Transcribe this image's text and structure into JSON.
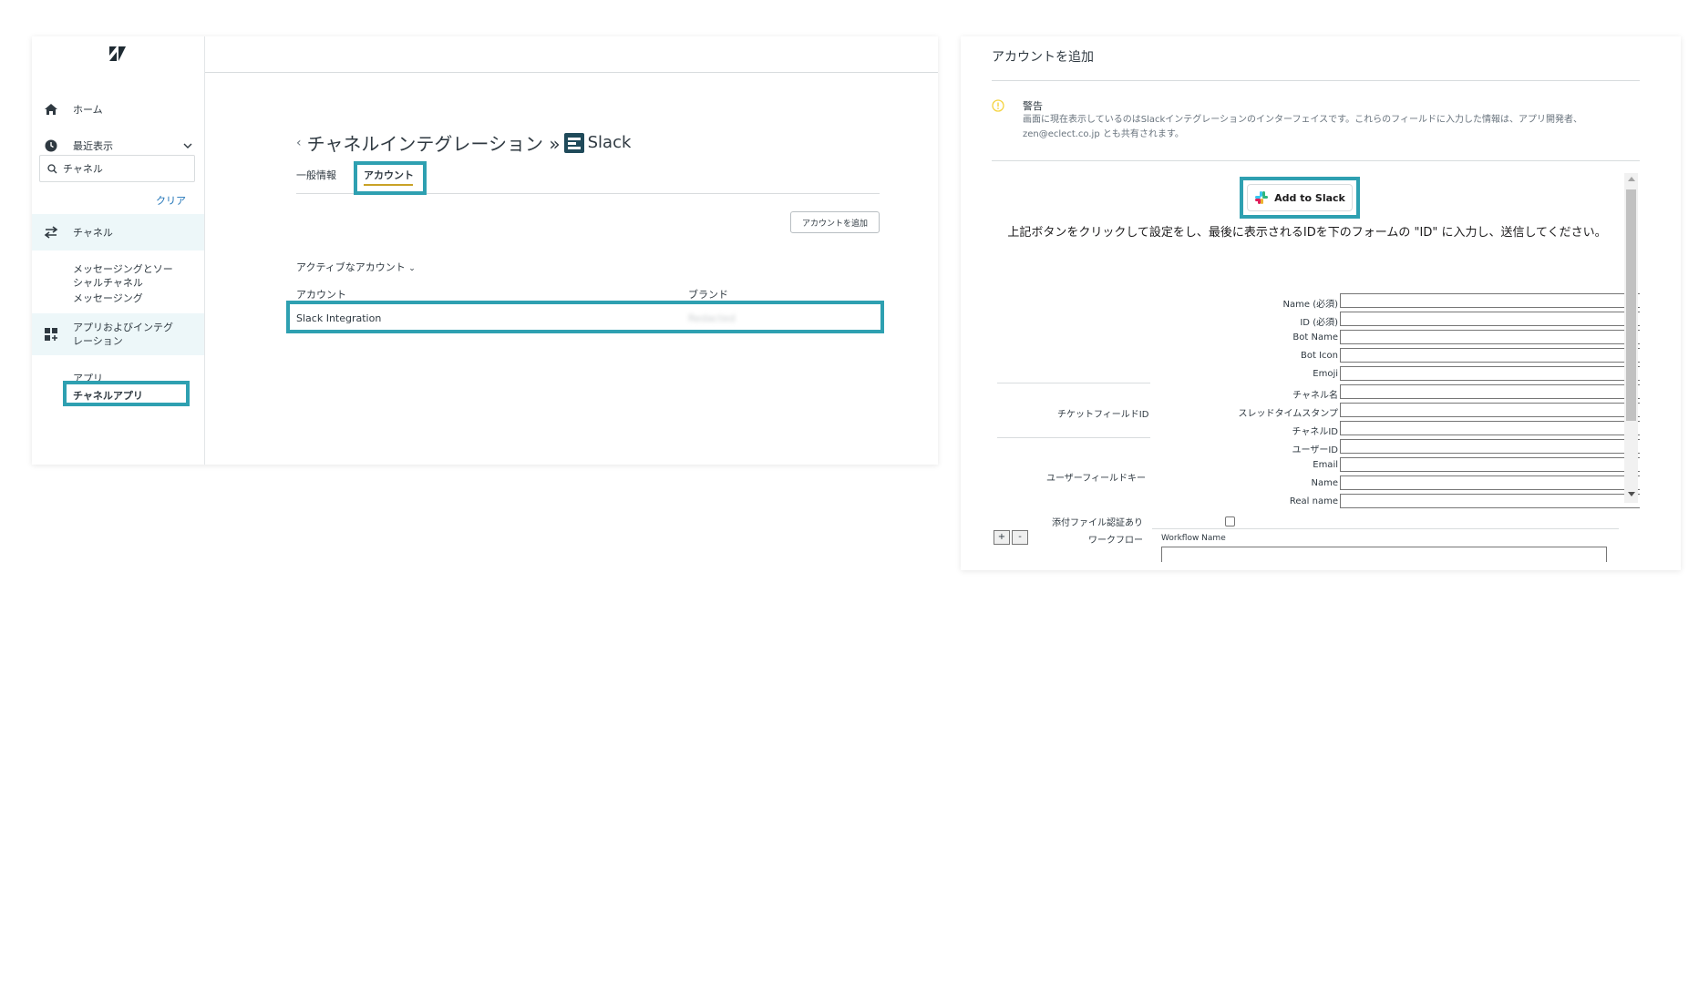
{
  "sidebar": {
    "home_label": "ホーム",
    "recent_label": "最近表示",
    "search_value": "チャネル",
    "clear_label": "クリア",
    "channels_label": "チャネル",
    "messaging_social_label": "メッセージングとソーシャルチャネル",
    "messaging_label": "メッセージング",
    "apps_integrations_label": "アプリおよびインテグレーション",
    "apps_label": "アプリ",
    "channel_apps_label": "チャネルアプリ"
  },
  "main": {
    "back_chevron": "‹",
    "title": "チャネルインテグレーション »",
    "title_app": "Slack",
    "tabs": [
      "一般情報",
      "アカウント"
    ],
    "add_account_button": "アカウントを追加",
    "active_accounts_label": "アクティブなアカウント",
    "table": {
      "headers": [
        "アカウント",
        "ブランド"
      ],
      "rows": [
        {
          "account": "Slack Integration",
          "brand": "Redacted"
        }
      ]
    }
  },
  "dialog": {
    "title": "アカウントを追加",
    "warning_title": "警告",
    "warning_text": "画面に現在表示しているのはSlackインテグレーションのインターフェイスです。これらのフィールドに入力した情報は、アプリ開発者、zen@eclect.co.jp とも共有されます。",
    "add_to_slack_label": "Add to Slack",
    "instruction": "上記ボタンをクリックして設定をし、最後に表示されるIDを下のフォームの \"ID\" に入力し、送信してください。",
    "fields": [
      "Name (必須)",
      "ID (必須)",
      "Bot Name",
      "Bot Icon",
      "Emoji"
    ],
    "ticket_group_label": "チケットフィールドID",
    "ticket_fields": [
      "チャネル名",
      "スレッドタイムスタンプ",
      "チャネルID"
    ],
    "user_group_label": "ユーザーフィールドキー",
    "user_fields": [
      "ユーザーID",
      "Email",
      "Name",
      "Real name"
    ],
    "attachment_label": "添付ファイル認証あり",
    "plus_label": "+",
    "minus_label": "-",
    "workflow_label": "ワークフロー",
    "workflow_name_label": "Workflow Name"
  },
  "colors": {
    "highlight": "#2ea0b1",
    "active_bg": "#edf7f9",
    "link_blue": "#1f73b7",
    "warning_yellow": "#f5d33f"
  }
}
